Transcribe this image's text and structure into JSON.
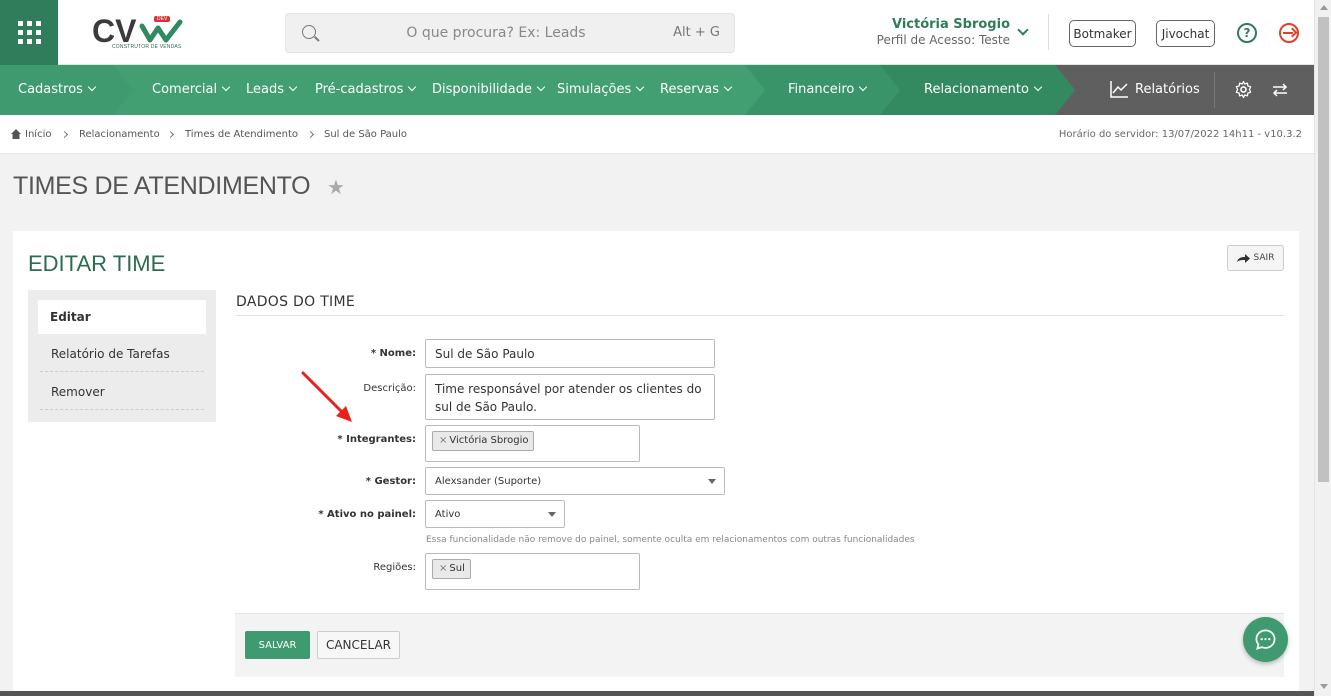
{
  "header": {
    "logo_text": "CV",
    "logo_badge": "DEV",
    "logo_subtitle": "CONSTRUTOR DE VENDAS",
    "search_placeholder": "O que procura? Ex: Leads",
    "search_shortcut": "Alt + G",
    "user_name": "Victória Sbrogio",
    "user_profile": "Perfil de Acesso: Teste",
    "btn_botmaker": "Botmaker",
    "btn_jivochat": "Jivochat",
    "help_label": "?"
  },
  "nav": {
    "items": [
      "Cadastros",
      "Comercial",
      "Leads",
      "Pré-cadastros",
      "Disponibilidade",
      "Simulações",
      "Reservas",
      "Financeiro",
      "Relacionamento"
    ],
    "reports": "Relatórios",
    "colors": {
      "primary": "#3f9b6f",
      "dark": "#2f7d5b",
      "tail": "#5f5f5f"
    }
  },
  "breadcrumb": {
    "items": [
      "Início",
      "Relacionamento",
      "Times de Atendimento",
      "Sul de São Paulo"
    ],
    "server_time": "Horário do servidor: 13/07/2022 14h11 - v10.3.2"
  },
  "page": {
    "title": "TIMES DE ATENDIMENTO",
    "card_title": "EDITAR TIME",
    "exit_label": "SAIR"
  },
  "sidemenu": {
    "items": [
      "Editar",
      "Relatório de Tarefas",
      "Remover"
    ]
  },
  "form": {
    "section_title": "DADOS DO TIME",
    "name_label": "Nome:",
    "name_value": "Sul de São Paulo",
    "description_label": "Descrição:",
    "description_value": "Time responsável por atender os clientes do sul de São Paulo.",
    "members_label": "Integrantes:",
    "members": [
      "Victória Sbrogio"
    ],
    "manager_label": "Gestor:",
    "manager_value": "Alexsander (Suporte)",
    "active_label": "Ativo no painel:",
    "active_value": "Ativo",
    "active_help": "Essa funcionalidade não remove do painel, somente oculta em relacionamentos com outras funcionalidades",
    "regions_label": "Regiões:",
    "regions": [
      "Sul"
    ],
    "required_mark": "*",
    "tag_remove": "×"
  },
  "actions": {
    "save": "SALVAR",
    "cancel": "CANCELAR"
  },
  "annotation": {
    "arrow_color": "#e8211b"
  }
}
